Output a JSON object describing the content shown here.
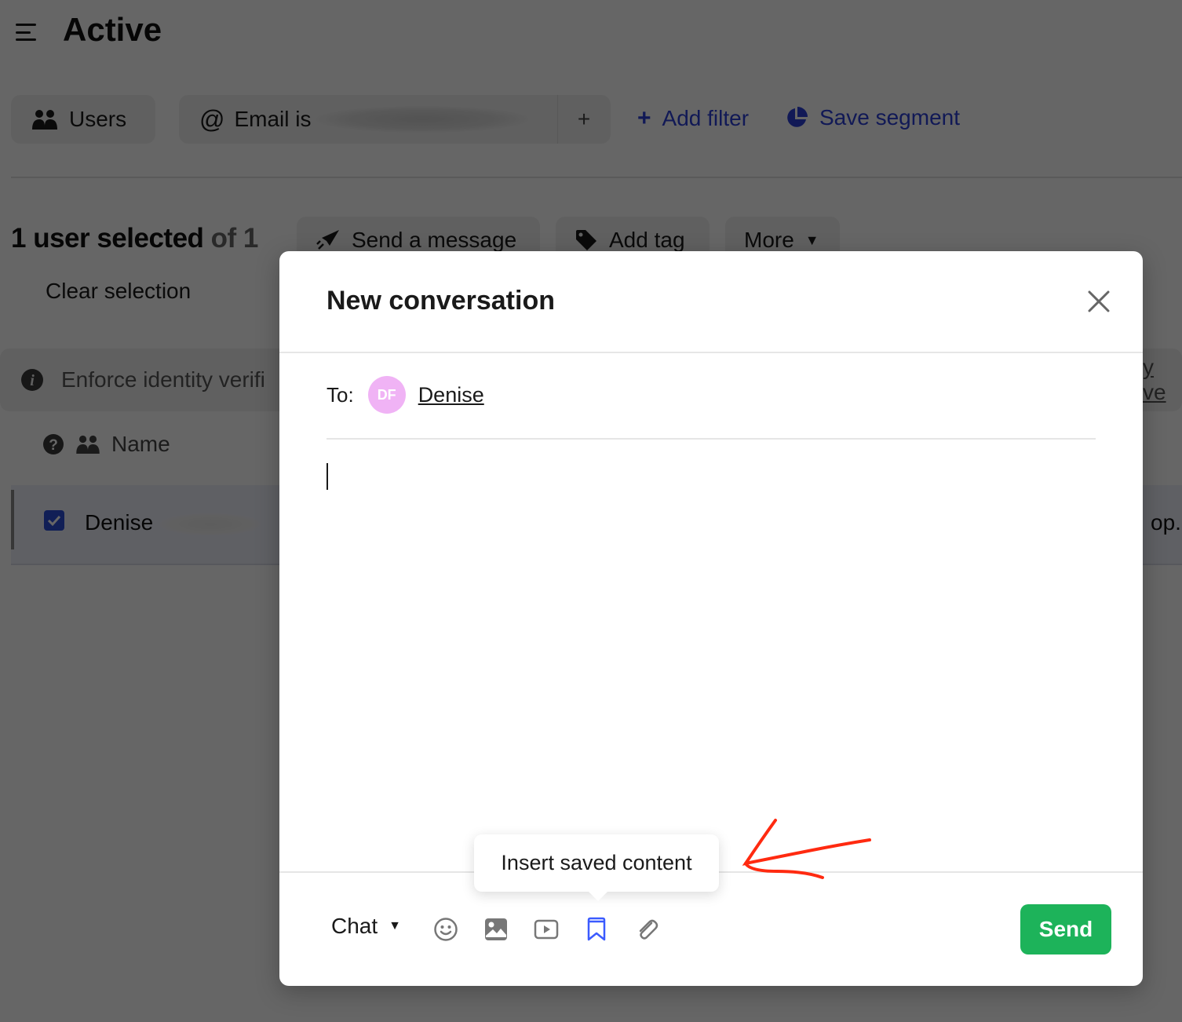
{
  "page": {
    "title": "Active",
    "filters": {
      "audience_chip": "Users",
      "email_chip_prefix": "Email is",
      "add_chip_symbol": "+",
      "add_filter": "Add filter",
      "save_segment": "Save segment"
    },
    "selection": {
      "count_text": "1 user selected",
      "of_text": "of 1",
      "clear": "Clear selection"
    },
    "actions": {
      "send_message": "Send a message",
      "add_tag": "Add tag",
      "more": "More"
    },
    "notice": {
      "text": "Enforce identity verifi",
      "link_fragment": "y ve"
    },
    "table": {
      "column_name": "Name",
      "rows": [
        {
          "name": "Denise",
          "email_fragment": "op.h",
          "checked": true
        }
      ]
    }
  },
  "modal": {
    "title": "New conversation",
    "to_label": "To:",
    "recipient": {
      "initials": "DF",
      "name": "Denise",
      "avatar_color": "#f0b3f5"
    },
    "composer_value": "",
    "channel": "Chat",
    "tools": [
      {
        "icon": "emoji-icon",
        "label": "Emoji"
      },
      {
        "icon": "image-icon",
        "label": "Image"
      },
      {
        "icon": "video-icon",
        "label": "Video"
      },
      {
        "icon": "bookmark-icon",
        "label": "Insert saved content",
        "active": true
      },
      {
        "icon": "paperclip-icon",
        "label": "Attachment"
      }
    ],
    "tooltip": "Insert saved content",
    "send": "Send"
  },
  "colors": {
    "accent_blue": "#2b3fd6",
    "send_green": "#1db35a",
    "annotation_red": "#ff2a10",
    "active_tool": "#3b5bff"
  }
}
